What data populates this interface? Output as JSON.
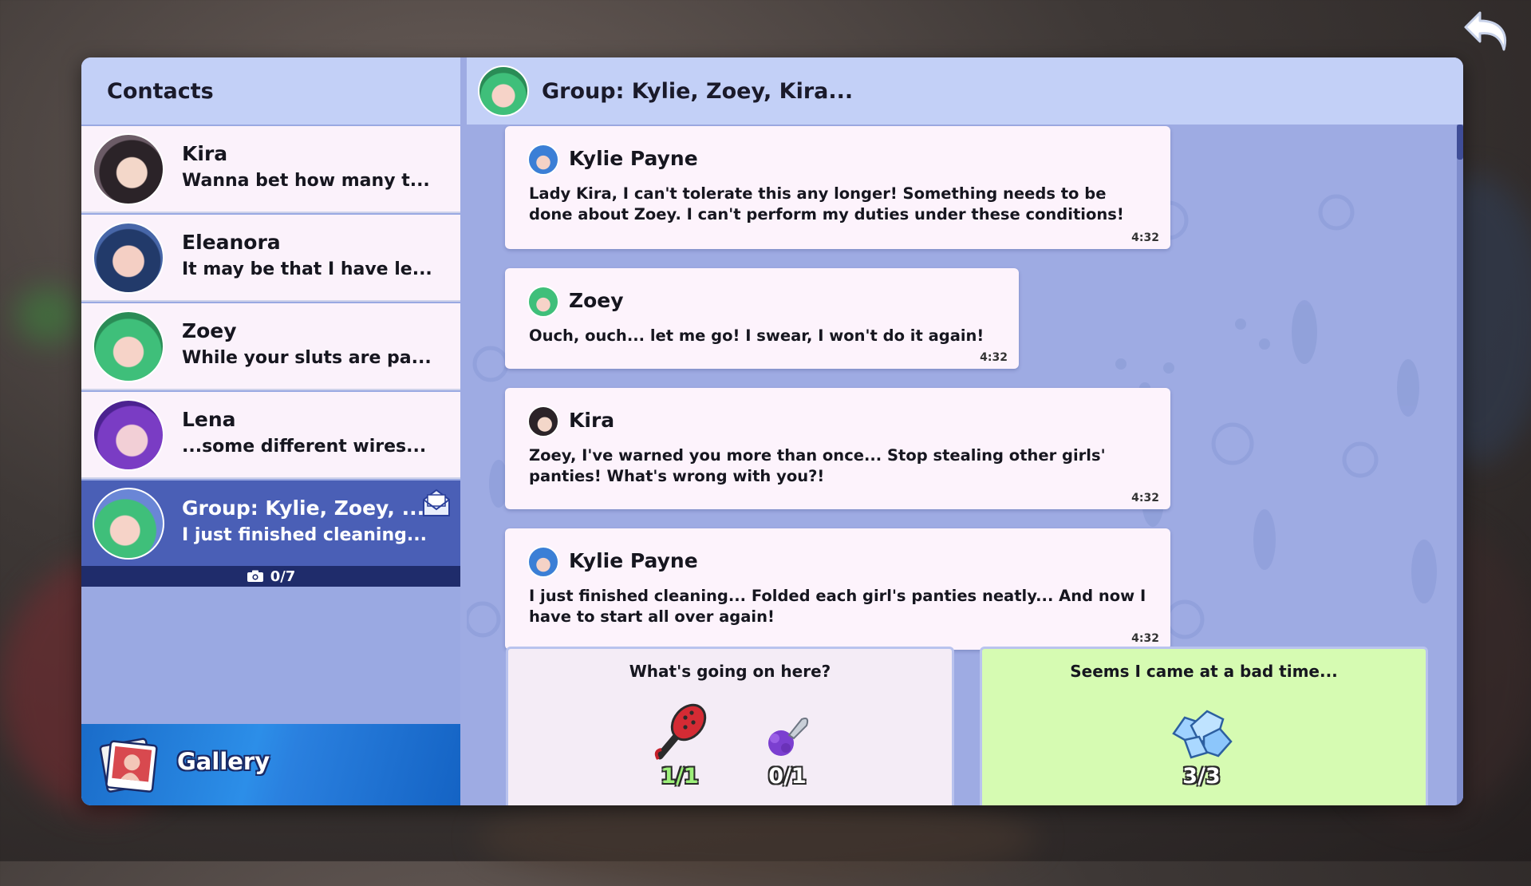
{
  "contacts": {
    "title": "Contacts",
    "items": [
      {
        "name": "Kira",
        "preview": "Wanna bet how many t..."
      },
      {
        "name": "Eleanora",
        "preview": "It may be that I have le..."
      },
      {
        "name": "Zoey",
        "preview": "While your sluts are pa..."
      },
      {
        "name": "Lena",
        "preview": "...some different wires..."
      },
      {
        "name": "Group: Kylie, Zoey, ...",
        "preview": "I just finished cleaning...",
        "photos": "0/7"
      }
    ],
    "gallery_label": "Gallery"
  },
  "chat": {
    "title": "Group: Kylie, Zoey, Kira...",
    "messages": [
      {
        "sender": "Kylie Payne",
        "text": "Lady Kira, I can't tolerate this any longer! Something needs to be done about Zoey. I can't perform my duties under these conditions!",
        "time": "4:32"
      },
      {
        "sender": "Zoey",
        "text": "Ouch, ouch... let me go! I swear, I won't do it again!",
        "time": "4:32"
      },
      {
        "sender": "Kira",
        "text": "Zoey, I've warned you more than once... Stop stealing other girls' panties! What's wrong with you?!",
        "time": "4:32"
      },
      {
        "sender": "Kylie Payne",
        "text": "I just finished cleaning... Folded each girl's panties neatly... And now I have to start all over again!",
        "time": "4:32"
      }
    ],
    "choices": [
      {
        "text": "What's going on here?",
        "rewards": [
          {
            "icon": "paddle-icon",
            "count": "1/1"
          },
          {
            "icon": "plug-icon",
            "count": "0/1"
          }
        ]
      },
      {
        "text": "Seems I came at a bad time...",
        "rewards": [
          {
            "icon": "diamonds-icon",
            "count": "3/3"
          }
        ]
      }
    ]
  },
  "colors": {
    "panel": "#9eabe3",
    "header": "#c3d0f7",
    "active_row": "#4a5fb6",
    "choice_green": "#d6fbb2",
    "choice_default": "#f4ecf6",
    "count_green": "#9df07a",
    "count_white": "#ffffff"
  }
}
